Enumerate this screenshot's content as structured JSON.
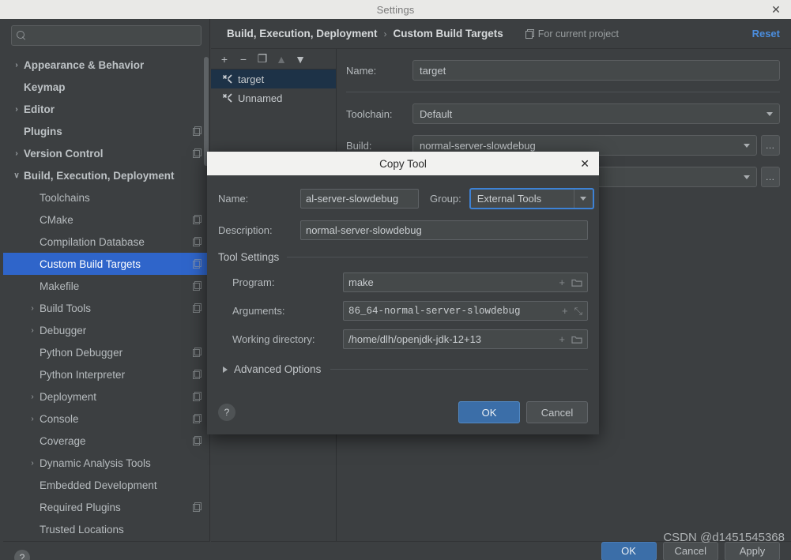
{
  "window": {
    "title": "Settings",
    "close_icon": "close-icon",
    "close_glyph": "✕"
  },
  "search": {
    "placeholder": "",
    "value": "",
    "icon": "search-icon"
  },
  "nav": {
    "items": [
      {
        "label": "Appearance & Behavior",
        "level": 0,
        "twisty": "›",
        "bold": true,
        "selected": false,
        "badge": false
      },
      {
        "label": "Keymap",
        "level": 0,
        "twisty": "",
        "bold": true,
        "selected": false,
        "badge": false
      },
      {
        "label": "Editor",
        "level": 0,
        "twisty": "›",
        "bold": true,
        "selected": false,
        "badge": false
      },
      {
        "label": "Plugins",
        "level": 0,
        "twisty": "",
        "bold": true,
        "selected": false,
        "badge": true
      },
      {
        "label": "Version Control",
        "level": 0,
        "twisty": "›",
        "bold": true,
        "selected": false,
        "badge": true
      },
      {
        "label": "Build, Execution, Deployment",
        "level": 0,
        "twisty": "∨",
        "bold": true,
        "selected": false,
        "badge": false
      },
      {
        "label": "Toolchains",
        "level": 1,
        "twisty": "",
        "bold": false,
        "selected": false,
        "badge": false
      },
      {
        "label": "CMake",
        "level": 1,
        "twisty": "",
        "bold": false,
        "selected": false,
        "badge": true
      },
      {
        "label": "Compilation Database",
        "level": 1,
        "twisty": "",
        "bold": false,
        "selected": false,
        "badge": true
      },
      {
        "label": "Custom Build Targets",
        "level": 1,
        "twisty": "",
        "bold": false,
        "selected": true,
        "badge": true
      },
      {
        "label": "Makefile",
        "level": 1,
        "twisty": "",
        "bold": false,
        "selected": false,
        "badge": true
      },
      {
        "label": "Build Tools",
        "level": 1,
        "twisty": "›",
        "bold": false,
        "selected": false,
        "badge": true
      },
      {
        "label": "Debugger",
        "level": 1,
        "twisty": "›",
        "bold": false,
        "selected": false,
        "badge": false
      },
      {
        "label": "Python Debugger",
        "level": 1,
        "twisty": "",
        "bold": false,
        "selected": false,
        "badge": true
      },
      {
        "label": "Python Interpreter",
        "level": 1,
        "twisty": "",
        "bold": false,
        "selected": false,
        "badge": true
      },
      {
        "label": "Deployment",
        "level": 1,
        "twisty": "›",
        "bold": false,
        "selected": false,
        "badge": true
      },
      {
        "label": "Console",
        "level": 1,
        "twisty": "›",
        "bold": false,
        "selected": false,
        "badge": true
      },
      {
        "label": "Coverage",
        "level": 1,
        "twisty": "",
        "bold": false,
        "selected": false,
        "badge": true
      },
      {
        "label": "Dynamic Analysis Tools",
        "level": 1,
        "twisty": "›",
        "bold": false,
        "selected": false,
        "badge": false
      },
      {
        "label": "Embedded Development",
        "level": 1,
        "twisty": "",
        "bold": false,
        "selected": false,
        "badge": false
      },
      {
        "label": "Required Plugins",
        "level": 1,
        "twisty": "",
        "bold": false,
        "selected": false,
        "badge": true
      },
      {
        "label": "Trusted Locations",
        "level": 1,
        "twisty": "",
        "bold": false,
        "selected": false,
        "badge": false
      }
    ],
    "help_glyph": "?"
  },
  "breadcrumb": {
    "parent": "Build, Execution, Deployment",
    "separator": "›",
    "current": "Custom Build Targets",
    "scope_label": "For current project",
    "scope_icon": "project-scope-icon",
    "reset_label": "Reset",
    "reset_color": "#4b8ddd"
  },
  "target_list": {
    "toolbar": [
      {
        "name": "add-target-button",
        "glyph": "+",
        "disabled": false
      },
      {
        "name": "remove-target-button",
        "glyph": "−",
        "disabled": false
      },
      {
        "name": "copy-target-button",
        "glyph": "❐",
        "disabled": false
      },
      {
        "name": "move-up-button",
        "glyph": "▲",
        "disabled": true
      },
      {
        "name": "move-down-button",
        "glyph": "▼",
        "disabled": false
      }
    ],
    "items": [
      {
        "label": "target",
        "selected": true
      },
      {
        "label": "Unnamed",
        "selected": false
      }
    ]
  },
  "detail": {
    "name_label": "Name:",
    "name_value": "target",
    "toolchain_label": "Toolchain:",
    "toolchain_value": "Default",
    "build_label": "Build:",
    "build_value": "normal-server-slowdebug",
    "dots_label": "…"
  },
  "settings_footer": {
    "ok": "OK",
    "cancel": "Cancel",
    "apply": "Apply"
  },
  "watermark": "CSDN @d1451545368",
  "dialog": {
    "title": "Copy Tool",
    "close_glyph": "✕",
    "name_label": "Name:",
    "name_value": "al-server-slowdebug",
    "group_label": "Group:",
    "group_value": "External Tools",
    "description_label": "Description:",
    "description_value": "normal-server-slowdebug",
    "section_title": "Tool Settings",
    "program_label": "Program:",
    "program_value": "make",
    "arguments_label": "Arguments:",
    "arguments_value": "86_64-normal-server-slowdebug",
    "workdir_label": "Working directory:",
    "workdir_value": "/home/dlh/openjdk-jdk-12+13",
    "insert_macro_glyph": "+",
    "browse_glyph": "🗀",
    "expand_glyph": "⤡",
    "advanced_label": "Advanced Options",
    "help_glyph": "?",
    "ok_label": "OK",
    "cancel_label": "Cancel",
    "accent_focus_color": "#3d82d6"
  }
}
